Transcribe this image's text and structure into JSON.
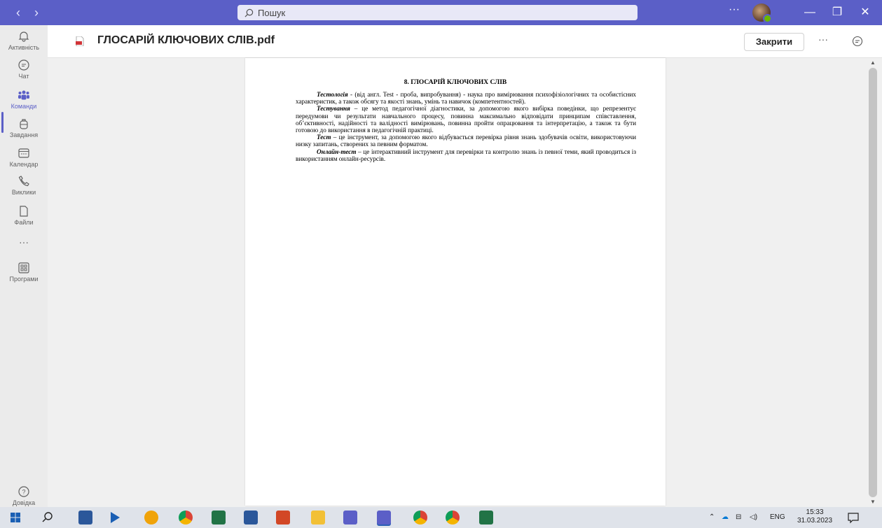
{
  "titlebar": {
    "search_placeholder": "Пошук",
    "more": "···",
    "minimize": "—",
    "maximize": "❐",
    "close": "✕"
  },
  "rail": {
    "items": [
      {
        "label": "Активність",
        "icon": "bell-icon"
      },
      {
        "label": "Чат",
        "icon": "chat-icon"
      },
      {
        "label": "Команди",
        "icon": "teams-icon"
      },
      {
        "label": "Завдання",
        "icon": "backpack-icon"
      },
      {
        "label": "Календар",
        "icon": "calendar-icon"
      },
      {
        "label": "Виклики",
        "icon": "phone-icon"
      },
      {
        "label": "Файли",
        "icon": "file-icon"
      },
      {
        "label": "···",
        "icon": "more-icon"
      },
      {
        "label": "Програми",
        "icon": "apps-icon"
      }
    ],
    "help": "Довідка",
    "active": "Команди",
    "accent": "#5b5fc7"
  },
  "header": {
    "file_name": "ГЛОСАРІЙ КЛЮЧОВИХ СЛІВ.pdf",
    "close_label": "Закрити",
    "more": "···"
  },
  "document": {
    "heading": "8. ГЛОСАРІЙ КЛЮЧОВИХ СЛІВ",
    "paragraphs": [
      {
        "term": "Тестологія",
        "text": " - (від англ. Test - проба, випробування) - наука про вимірювання психофізіологічних та особистісних характеристик, а також обсягу та якості знань, умінь та навичок (компетентностей)."
      },
      {
        "term": "Тестування",
        "text": " – це метод педагогічної діагностики, за допомогою якого вибірка поведінки, що репрезентує передумови чи результати навчального процесу, повинна максимально відповідати принципам співставлення, об’єктивності, надійності та валідності вимірювань, повинна пройти опрацювання та інтерпретацію, а також та бути готовою до використання в педагогічній практиці."
      },
      {
        "term": "Тест",
        "text": " – це інструмент, за допомогою якого відбувається перевірка рівня знань здобувачів освіти, використовуючи низку запитань, створених за певним форматом."
      },
      {
        "term": "Онлайн-тест",
        "text": " – це інтерактивний інструмент для перевірки та контролю знань із певної теми, який проводиться із використанням онлайн-ресурсів."
      }
    ]
  },
  "taskbar": {
    "lang": "ENG",
    "time": "15:33",
    "date": "31.03.2023"
  }
}
